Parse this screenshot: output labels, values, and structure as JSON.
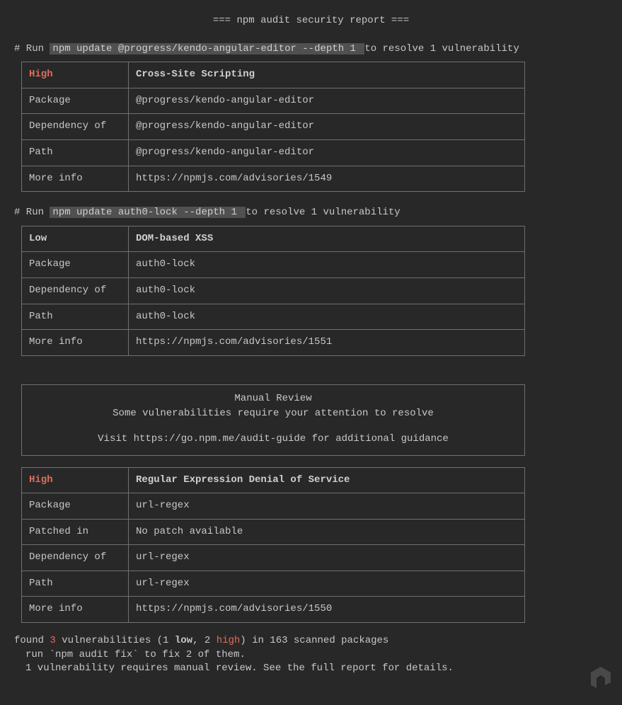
{
  "header": "=== npm audit security report ===",
  "runPrefix": "# Run ",
  "resolveSuffix": " to resolve 1 vulnerability",
  "labels": {
    "package": "Package",
    "dependencyOf": "Dependency of",
    "path": "Path",
    "moreInfo": "More info",
    "patchedIn": "Patched in"
  },
  "vuln1": {
    "cmd": " npm update @progress/kendo-angular-editor --depth 1 ",
    "severityLabel": "High",
    "severityClass": "high",
    "title": "Cross-Site Scripting",
    "package": "@progress/kendo-angular-editor",
    "dependencyOf": "@progress/kendo-angular-editor",
    "path": "@progress/kendo-angular-editor",
    "moreInfo": "https://npmjs.com/advisories/1549"
  },
  "vuln2": {
    "cmd": " npm update auth0-lock --depth 1 ",
    "severityLabel": "Low",
    "severityClass": "low",
    "title": "DOM-based XSS",
    "package": "auth0-lock",
    "dependencyOf": "auth0-lock",
    "path": "auth0-lock",
    "moreInfo": "https://npmjs.com/advisories/1551"
  },
  "manual": {
    "title": "Manual Review",
    "line1": "Some vulnerabilities require your attention to resolve",
    "line2": "Visit https://go.npm.me/audit-guide for additional guidance"
  },
  "vuln3": {
    "severityLabel": "High",
    "severityClass": "high",
    "title": "Regular Expression Denial of Service",
    "package": "url-regex",
    "patchedIn": "No patch available",
    "dependencyOf": "url-regex",
    "path": "url-regex",
    "moreInfo": "https://npmjs.com/advisories/1550"
  },
  "summary": {
    "foundPrefix": "found ",
    "count": "3",
    "midA": " vulnerabilities (1 ",
    "lowWord": "low",
    "midB": ", 2 ",
    "highWord": "high",
    "midC": ") in 163 scanned packages",
    "line2": "run `npm audit fix` to fix 2 of them.",
    "line3": "1 vulnerability requires manual review. See the full report for details."
  }
}
